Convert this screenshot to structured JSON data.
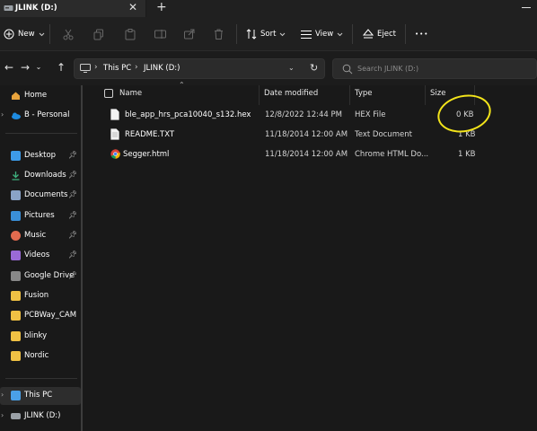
{
  "window": {
    "tab_title": "JLINK (D:)",
    "close_glyph": "✕",
    "add_glyph": "+"
  },
  "toolbar": {
    "new_label": "New",
    "sort_label": "Sort",
    "view_label": "View",
    "eject_label": "Eject",
    "more_glyph": "•••"
  },
  "address": {
    "crumbs": [
      "This PC",
      "JLINK (D:)"
    ],
    "search_placeholder": "Search JLINK (D:)"
  },
  "sidebar": {
    "items": [
      {
        "label": "Home",
        "icon": "home-icon",
        "color": "#e8a33c",
        "pinned": false
      },
      {
        "label": "B - Personal",
        "icon": "onedrive-icon",
        "color": "#1e8be0",
        "pinned": false,
        "expandable": true
      },
      {
        "label": "Desktop",
        "icon": "desktop-icon",
        "color": "#3d9be9",
        "pinned": true
      },
      {
        "label": "Downloads",
        "icon": "downloads-icon",
        "color": "#3fb27f",
        "pinned": true
      },
      {
        "label": "Documents",
        "icon": "documents-icon",
        "color": "#8aa3c7",
        "pinned": true
      },
      {
        "label": "Pictures",
        "icon": "pictures-icon",
        "color": "#3a8fd8",
        "pinned": true
      },
      {
        "label": "Music",
        "icon": "music-icon",
        "color": "#e26b4f",
        "pinned": true
      },
      {
        "label": "Videos",
        "icon": "videos-icon",
        "color": "#9a6ad6",
        "pinned": true
      },
      {
        "label": "Google Drive",
        "icon": "google-drive-icon",
        "color": "#888888",
        "pinned": true
      },
      {
        "label": "Fusion",
        "icon": "folder-icon",
        "color": "#f0c144",
        "pinned": false
      },
      {
        "label": "PCBWay_CAM",
        "icon": "folder-icon",
        "color": "#f0c144",
        "pinned": false
      },
      {
        "label": "blinky",
        "icon": "folder-icon",
        "color": "#f0c144",
        "pinned": false
      },
      {
        "label": "Nordic",
        "icon": "folder-icon",
        "color": "#f0c144",
        "pinned": false
      },
      {
        "label": "This PC",
        "icon": "this-pc-icon",
        "color": "#4aa0e8",
        "pinned": false,
        "expandable": true,
        "selected": true
      },
      {
        "label": "JLINK (D:)",
        "icon": "usb-drive-icon",
        "color": "#9aa0a6",
        "pinned": false,
        "expandable": true
      }
    ]
  },
  "columns": {
    "name": "Name",
    "date": "Date modified",
    "type": "Type",
    "size": "Size"
  },
  "files": [
    {
      "name": "ble_app_hrs_pca10040_s132.hex",
      "date": "12/8/2022 12:44 PM",
      "type": "HEX File",
      "size": "0 KB",
      "icon": "file-icon"
    },
    {
      "name": "README.TXT",
      "date": "11/18/2014 12:00 AM",
      "type": "Text Document",
      "size": "1 KB",
      "icon": "text-file-icon"
    },
    {
      "name": "Segger.html",
      "date": "11/18/2014 12:00 AM",
      "type": "Chrome HTML Do...",
      "size": "1 KB",
      "icon": "chrome-icon"
    }
  ],
  "annotation": {
    "color": "#f3e41a"
  }
}
